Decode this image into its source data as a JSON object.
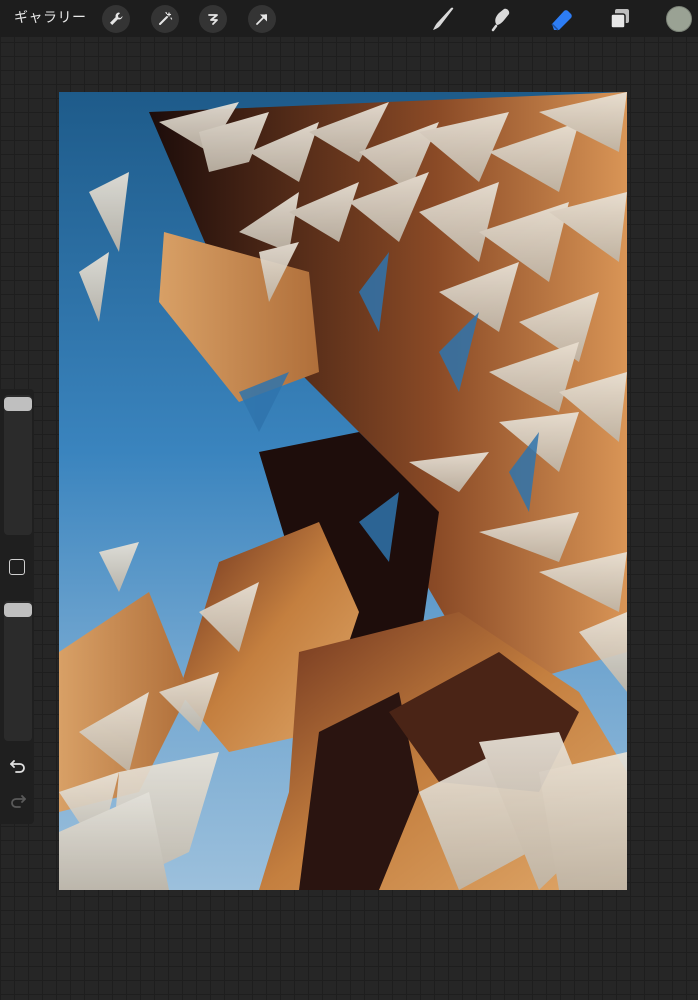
{
  "topbar": {
    "gallery_label": "ギャラリー",
    "actions": [
      {
        "name": "wrench-icon"
      },
      {
        "name": "magic-wand-icon"
      },
      {
        "name": "selection-icon"
      },
      {
        "name": "transform-arrow-icon"
      }
    ],
    "tools": [
      {
        "name": "brush-icon"
      },
      {
        "name": "smudge-icon"
      },
      {
        "name": "eraser-icon",
        "active": true
      },
      {
        "name": "layers-icon"
      }
    ],
    "current_color": "#9aa294"
  },
  "sidebar": {
    "controls": [
      "brush-size-slider",
      "modify-button",
      "opacity-slider",
      "undo-icon",
      "redo-icon"
    ]
  },
  "canvas": {
    "description_colors": [
      "#1e5b8a",
      "#c88a4b",
      "#3a1a14",
      "#e8e2d8"
    ]
  }
}
